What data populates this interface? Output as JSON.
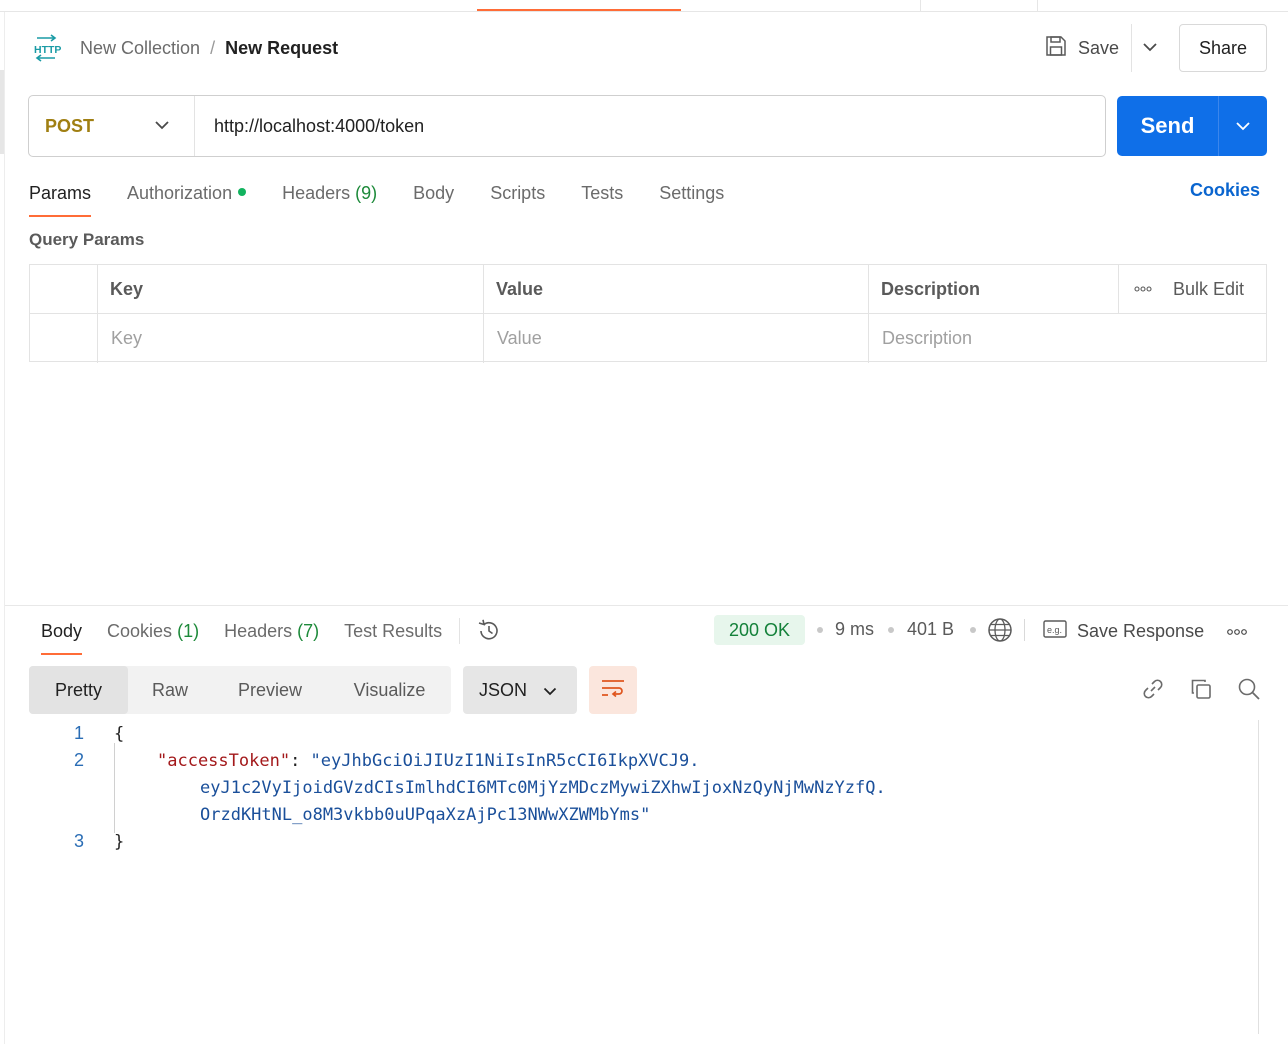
{
  "breadcrumb": {
    "icon": "http-icon",
    "collection": "New Collection",
    "separator": "/",
    "request": "New Request"
  },
  "header_actions": {
    "save": "Save",
    "share": "Share"
  },
  "request": {
    "method": "POST",
    "url": "http://localhost:4000/token",
    "send": "Send"
  },
  "request_tabs": {
    "params": "Params",
    "authorization": "Authorization",
    "headers": "Headers",
    "headers_count": "(9)",
    "body": "Body",
    "scripts": "Scripts",
    "tests": "Tests",
    "settings": "Settings",
    "cookies": "Cookies"
  },
  "query_params": {
    "title": "Query Params",
    "columns": {
      "key": "Key",
      "value": "Value",
      "description": "Description",
      "bulk_edit": "Bulk Edit"
    },
    "placeholders": {
      "key": "Key",
      "value": "Value",
      "description": "Description"
    }
  },
  "response_tabs": {
    "body": "Body",
    "cookies": "Cookies",
    "cookies_count": "(1)",
    "headers": "Headers",
    "headers_count": "(7)",
    "test_results": "Test Results"
  },
  "response_meta": {
    "status": "200 OK",
    "time": "9 ms",
    "size": "401 B",
    "save_response": "Save Response"
  },
  "format_bar": {
    "modes": [
      "Pretty",
      "Raw",
      "Preview",
      "Visualize"
    ],
    "active_mode": "Pretty",
    "language": "JSON"
  },
  "code": {
    "line_numbers": [
      "1",
      "2",
      "3"
    ],
    "open_brace": "{",
    "key": "\"accessToken\"",
    "colon": ": ",
    "value_line1": "\"eyJhbGciOiJIUzI1NiIsInR5cCI6IkpXVCJ9.",
    "value_line2": "eyJ1c2VyIjoidGVzdCIsImlhdCI6MTc0MjYzMDczMywiZXhwIjoxNzQyNjMwNzYzfQ.",
    "value_line3": "OrzdKHtNL_o8M3vkbb0uUPqaXzAjPc13NWwXZWMbYms\"",
    "close_brace": "}"
  },
  "colors": {
    "accent": "#ff6c37",
    "send": "#0f6fe8",
    "method": "#a07f12",
    "status_ok": "#14813a",
    "cookies_link": "#0a65cf"
  }
}
